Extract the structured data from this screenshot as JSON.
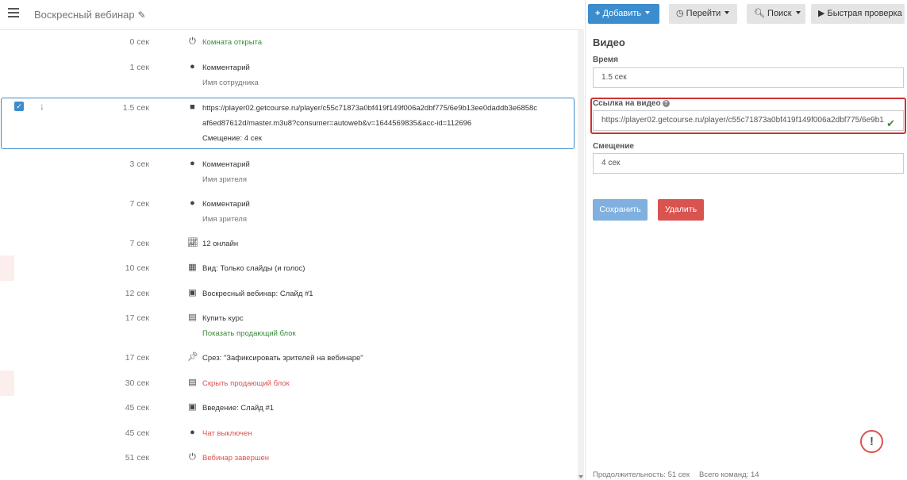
{
  "header": {
    "title": "Воскресный вебинар",
    "add_label": "Добавить",
    "goto_label": "Перейти",
    "search_label": "Поиск",
    "quickcheck_label": "Быстрая проверка"
  },
  "events": [
    {
      "time": "0 сек",
      "icon": "power-icon",
      "lines": [
        "Комната открыта"
      ]
    },
    {
      "time": "1 сек",
      "icon": "comment-icon",
      "lines": [
        "Комментарий",
        "Имя сотрудника"
      ]
    },
    {
      "time": "1.5 сек",
      "icon": "video-icon",
      "lines": [
        "https://player02.getcourse.ru/player/c55c71873a0bf419f149f006a2dbf775/6e9b13ee0daddb3e6858c",
        "af6ed87612d/master.m3u8?consumer=autoweb&v=1644569835&acc-id=112696",
        "Смещение: 4 сек"
      ]
    },
    {
      "time": "3 сек",
      "icon": "comment-icon",
      "lines": [
        "Комментарий",
        "Имя зрителя"
      ]
    },
    {
      "time": "7 сек",
      "icon": "comment-icon",
      "lines": [
        "Комментарий",
        "Имя зрителя"
      ]
    },
    {
      "time": "7 сек",
      "icon": "chart-icon",
      "lines": [
        "12 онлайн"
      ]
    },
    {
      "time": "10 сек",
      "icon": "grid-icon",
      "lines": [
        "Вид: Только слайды (и голос)"
      ]
    },
    {
      "time": "12 сек",
      "icon": "image-icon",
      "lines": [
        "Воскресный вебинар: Слайд #1"
      ]
    },
    {
      "time": "17 сек",
      "icon": "money-icon",
      "lines": [
        "Купить курс",
        "Показать продающий блок"
      ]
    },
    {
      "time": "17 сек",
      "icon": "pin-icon",
      "lines": [
        "Срез: \"Зафиксировать зрителей на вебинаре\""
      ]
    },
    {
      "time": "30 сек",
      "icon": "money-icon",
      "lines": [
        "Скрыть продающий блок"
      ]
    },
    {
      "time": "45 сек",
      "icon": "image-icon",
      "lines": [
        "Введение: Слайд #1"
      ]
    },
    {
      "time": "45 сек",
      "icon": "comments-icon",
      "lines": [
        "Чат выключен"
      ]
    },
    {
      "time": "51 сек",
      "icon": "power-icon",
      "lines": [
        "Вебинар завершен"
      ]
    }
  ],
  "panel": {
    "title": "Видео",
    "time_label": "Время",
    "time_value": "1.5 сек",
    "link_label": "Ссылка на видео",
    "link_value": "https://player02.getcourse.ru/player/c55c71873a0bf419f149f006a2dbf775/6e9b1",
    "offset_label": "Смещение",
    "offset_value": "4 сек",
    "save_label": "Сохранить",
    "delete_label": "Удалить"
  },
  "footer": {
    "duration": "Продолжительность: 51 сек",
    "commands": "Всего команд: 14"
  },
  "colors": {
    "primary": "#3c8dce",
    "danger": "#d9534f",
    "success": "#3a8a3a"
  }
}
